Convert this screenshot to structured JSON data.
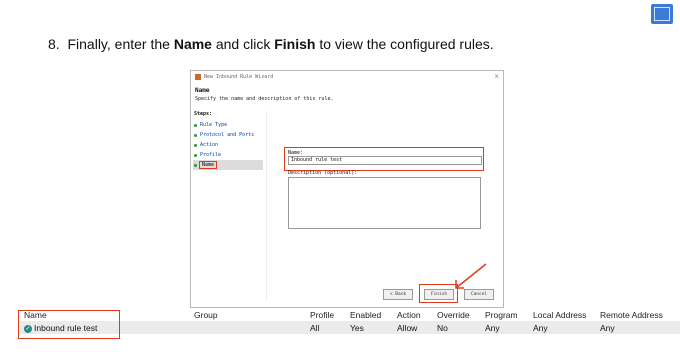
{
  "instruction": {
    "number": "8.",
    "text_before": "Finally, enter the ",
    "bold_name": "Name",
    "text_middle": " and click ",
    "bold_finish": "Finish",
    "text_after": " to view the configured rules."
  },
  "wizard": {
    "title": "New Inbound Rule Wizard",
    "close_glyph": "×",
    "heading": "Name",
    "subtitle": "Specify the name and description of this rule.",
    "steps_label": "Steps:",
    "steps": [
      {
        "label": "Rule Type"
      },
      {
        "label": "Protocol and Ports"
      },
      {
        "label": "Action"
      },
      {
        "label": "Profile"
      },
      {
        "label": "Name"
      }
    ],
    "name_label": "Name:",
    "name_value": "Inbound rule test",
    "description_label": "Description (optional):",
    "buttons": {
      "back": "< Back",
      "finish": "Finish",
      "cancel": "Cancel"
    }
  },
  "rules_table": {
    "columns": [
      "Name",
      "Group",
      "Profile",
      "Enabled",
      "Action",
      "Override",
      "Program",
      "Local Address",
      "Remote Address"
    ],
    "rows": [
      {
        "name": "Inbound rule test",
        "group": "",
        "profile": "All",
        "enabled": "Yes",
        "action": "Allow",
        "override": "No",
        "program": "Any",
        "local_address": "Any",
        "remote_address": "Any"
      }
    ]
  },
  "colors": {
    "highlight": "#e03a1a",
    "accent": "#3a7bd5"
  }
}
